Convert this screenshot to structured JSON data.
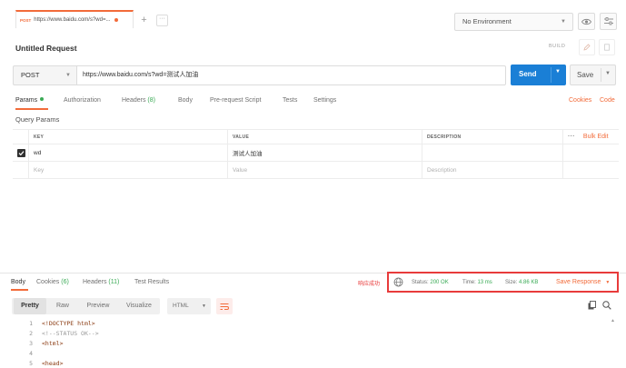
{
  "tabbar": {
    "tab": {
      "method": "POST",
      "url": "https://www.baidu.com/s?wd=..."
    },
    "add": "+",
    "more": "···",
    "environment": "No Environment"
  },
  "request": {
    "title": "Untitled Request",
    "build": "BUILD",
    "method": "POST",
    "url": "https://www.baidu.com/s?wd=测试人加油",
    "send": "Send",
    "save": "Save"
  },
  "req_tabs": [
    {
      "label": "Params",
      "count": ""
    },
    {
      "label": "Authorization",
      "count": ""
    },
    {
      "label": "Headers",
      "count": "(8)"
    },
    {
      "label": "Body",
      "count": ""
    },
    {
      "label": "Pre-request Script",
      "count": ""
    },
    {
      "label": "Tests",
      "count": ""
    },
    {
      "label": "Settings",
      "count": ""
    }
  ],
  "links": {
    "cookies": "Cookies",
    "code": "Code"
  },
  "params": {
    "section": "Query Params",
    "headers": {
      "key": "KEY",
      "value": "VALUE",
      "description": "DESCRIPTION",
      "more": "···",
      "bulk": "Bulk Edit"
    },
    "rows": [
      {
        "key": "wd",
        "value": "测试人加油",
        "checked": true
      }
    ],
    "placeholder": {
      "key": "Key",
      "value": "Value",
      "description": "Description"
    }
  },
  "response": {
    "tabs": [
      {
        "label": "Body",
        "count": ""
      },
      {
        "label": "Cookies",
        "count": "(6)"
      },
      {
        "label": "Headers",
        "count": "(11)"
      },
      {
        "label": "Test Results",
        "count": ""
      }
    ],
    "annotation": "响应成功",
    "status_label": "Status:",
    "status": "200 OK",
    "time_label": "Time:",
    "time": "13 ms",
    "size_label": "Size:",
    "size": "4.86 KB",
    "save_response": "Save Response",
    "views": [
      "Pretty",
      "Raw",
      "Preview",
      "Visualize"
    ],
    "format": "HTML",
    "code": [
      {
        "n": "1",
        "text": "<!DOCTYPE html>"
      },
      {
        "n": "2",
        "text": "<!--STATUS OK-->"
      },
      {
        "n": "3",
        "text": "<html>"
      },
      {
        "n": "4",
        "text": ""
      },
      {
        "n": "5",
        "text": "<head>"
      }
    ]
  },
  "colors": {
    "accent": "#f26b3a",
    "send": "#1a7fd6",
    "success": "#3aaa55",
    "annotation": "#e83b3b"
  }
}
